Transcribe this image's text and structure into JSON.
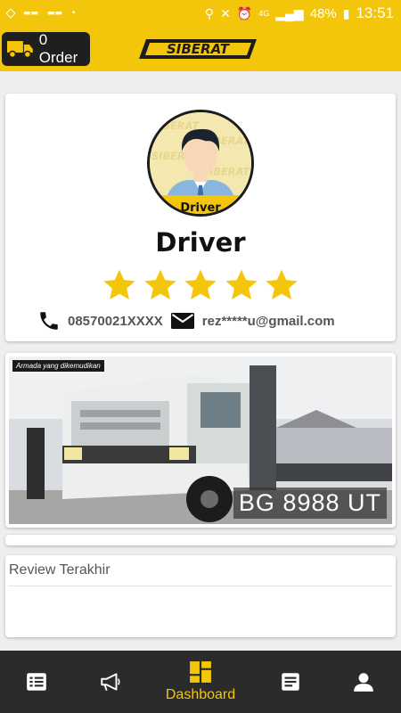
{
  "status_bar": {
    "network": "4G",
    "battery": "48%",
    "time": "13:51"
  },
  "header": {
    "order_label": "0 Order",
    "logo_text": "SIBERAT",
    "brand_color": "#f3c60b"
  },
  "profile": {
    "avatar_badge": "Driver",
    "name": "Driver",
    "rating": 5,
    "rating_max": 5,
    "phone": "08570021XXXX",
    "email": "rez*****u@gmail.com"
  },
  "vehicle": {
    "photo_caption": "Armada yang dikemudikan",
    "plate": "BG 8988 UT"
  },
  "review": {
    "title": "Review Terakhir"
  },
  "bottom_nav": {
    "items": [
      {
        "icon": "list-icon",
        "label": ""
      },
      {
        "icon": "megaphone-icon",
        "label": ""
      },
      {
        "icon": "dashboard-icon",
        "label": "Dashboard",
        "active": true
      },
      {
        "icon": "document-icon",
        "label": ""
      },
      {
        "icon": "user-icon",
        "label": ""
      }
    ]
  }
}
